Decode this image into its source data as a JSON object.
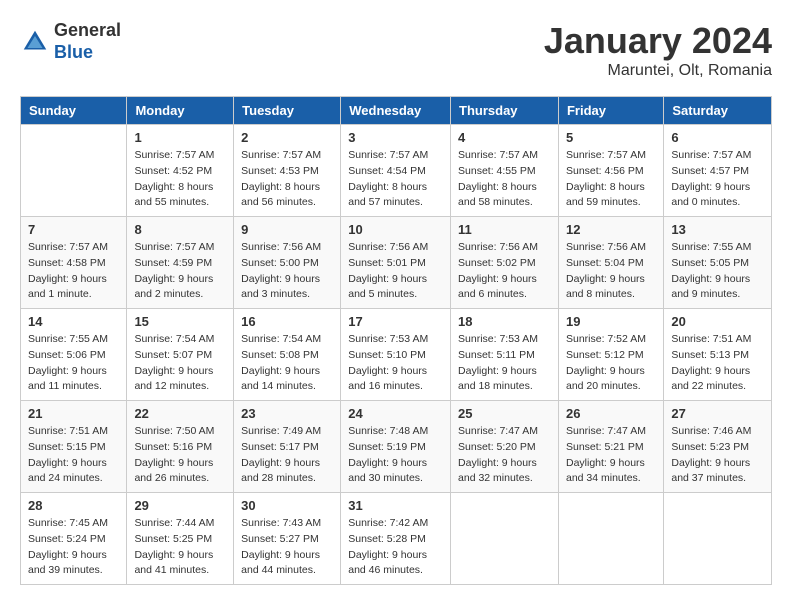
{
  "header": {
    "logo_general": "General",
    "logo_blue": "Blue",
    "month_title": "January 2024",
    "location": "Maruntei, Olt, Romania"
  },
  "days_of_week": [
    "Sunday",
    "Monday",
    "Tuesday",
    "Wednesday",
    "Thursday",
    "Friday",
    "Saturday"
  ],
  "weeks": [
    [
      {
        "day": "",
        "info": ""
      },
      {
        "day": "1",
        "info": "Sunrise: 7:57 AM\nSunset: 4:52 PM\nDaylight: 8 hours\nand 55 minutes."
      },
      {
        "day": "2",
        "info": "Sunrise: 7:57 AM\nSunset: 4:53 PM\nDaylight: 8 hours\nand 56 minutes."
      },
      {
        "day": "3",
        "info": "Sunrise: 7:57 AM\nSunset: 4:54 PM\nDaylight: 8 hours\nand 57 minutes."
      },
      {
        "day": "4",
        "info": "Sunrise: 7:57 AM\nSunset: 4:55 PM\nDaylight: 8 hours\nand 58 minutes."
      },
      {
        "day": "5",
        "info": "Sunrise: 7:57 AM\nSunset: 4:56 PM\nDaylight: 8 hours\nand 59 minutes."
      },
      {
        "day": "6",
        "info": "Sunrise: 7:57 AM\nSunset: 4:57 PM\nDaylight: 9 hours\nand 0 minutes."
      }
    ],
    [
      {
        "day": "7",
        "info": "Sunrise: 7:57 AM\nSunset: 4:58 PM\nDaylight: 9 hours\nand 1 minute."
      },
      {
        "day": "8",
        "info": "Sunrise: 7:57 AM\nSunset: 4:59 PM\nDaylight: 9 hours\nand 2 minutes."
      },
      {
        "day": "9",
        "info": "Sunrise: 7:56 AM\nSunset: 5:00 PM\nDaylight: 9 hours\nand 3 minutes."
      },
      {
        "day": "10",
        "info": "Sunrise: 7:56 AM\nSunset: 5:01 PM\nDaylight: 9 hours\nand 5 minutes."
      },
      {
        "day": "11",
        "info": "Sunrise: 7:56 AM\nSunset: 5:02 PM\nDaylight: 9 hours\nand 6 minutes."
      },
      {
        "day": "12",
        "info": "Sunrise: 7:56 AM\nSunset: 5:04 PM\nDaylight: 9 hours\nand 8 minutes."
      },
      {
        "day": "13",
        "info": "Sunrise: 7:55 AM\nSunset: 5:05 PM\nDaylight: 9 hours\nand 9 minutes."
      }
    ],
    [
      {
        "day": "14",
        "info": "Sunrise: 7:55 AM\nSunset: 5:06 PM\nDaylight: 9 hours\nand 11 minutes."
      },
      {
        "day": "15",
        "info": "Sunrise: 7:54 AM\nSunset: 5:07 PM\nDaylight: 9 hours\nand 12 minutes."
      },
      {
        "day": "16",
        "info": "Sunrise: 7:54 AM\nSunset: 5:08 PM\nDaylight: 9 hours\nand 14 minutes."
      },
      {
        "day": "17",
        "info": "Sunrise: 7:53 AM\nSunset: 5:10 PM\nDaylight: 9 hours\nand 16 minutes."
      },
      {
        "day": "18",
        "info": "Sunrise: 7:53 AM\nSunset: 5:11 PM\nDaylight: 9 hours\nand 18 minutes."
      },
      {
        "day": "19",
        "info": "Sunrise: 7:52 AM\nSunset: 5:12 PM\nDaylight: 9 hours\nand 20 minutes."
      },
      {
        "day": "20",
        "info": "Sunrise: 7:51 AM\nSunset: 5:13 PM\nDaylight: 9 hours\nand 22 minutes."
      }
    ],
    [
      {
        "day": "21",
        "info": "Sunrise: 7:51 AM\nSunset: 5:15 PM\nDaylight: 9 hours\nand 24 minutes."
      },
      {
        "day": "22",
        "info": "Sunrise: 7:50 AM\nSunset: 5:16 PM\nDaylight: 9 hours\nand 26 minutes."
      },
      {
        "day": "23",
        "info": "Sunrise: 7:49 AM\nSunset: 5:17 PM\nDaylight: 9 hours\nand 28 minutes."
      },
      {
        "day": "24",
        "info": "Sunrise: 7:48 AM\nSunset: 5:19 PM\nDaylight: 9 hours\nand 30 minutes."
      },
      {
        "day": "25",
        "info": "Sunrise: 7:47 AM\nSunset: 5:20 PM\nDaylight: 9 hours\nand 32 minutes."
      },
      {
        "day": "26",
        "info": "Sunrise: 7:47 AM\nSunset: 5:21 PM\nDaylight: 9 hours\nand 34 minutes."
      },
      {
        "day": "27",
        "info": "Sunrise: 7:46 AM\nSunset: 5:23 PM\nDaylight: 9 hours\nand 37 minutes."
      }
    ],
    [
      {
        "day": "28",
        "info": "Sunrise: 7:45 AM\nSunset: 5:24 PM\nDaylight: 9 hours\nand 39 minutes."
      },
      {
        "day": "29",
        "info": "Sunrise: 7:44 AM\nSunset: 5:25 PM\nDaylight: 9 hours\nand 41 minutes."
      },
      {
        "day": "30",
        "info": "Sunrise: 7:43 AM\nSunset: 5:27 PM\nDaylight: 9 hours\nand 44 minutes."
      },
      {
        "day": "31",
        "info": "Sunrise: 7:42 AM\nSunset: 5:28 PM\nDaylight: 9 hours\nand 46 minutes."
      },
      {
        "day": "",
        "info": ""
      },
      {
        "day": "",
        "info": ""
      },
      {
        "day": "",
        "info": ""
      }
    ]
  ]
}
